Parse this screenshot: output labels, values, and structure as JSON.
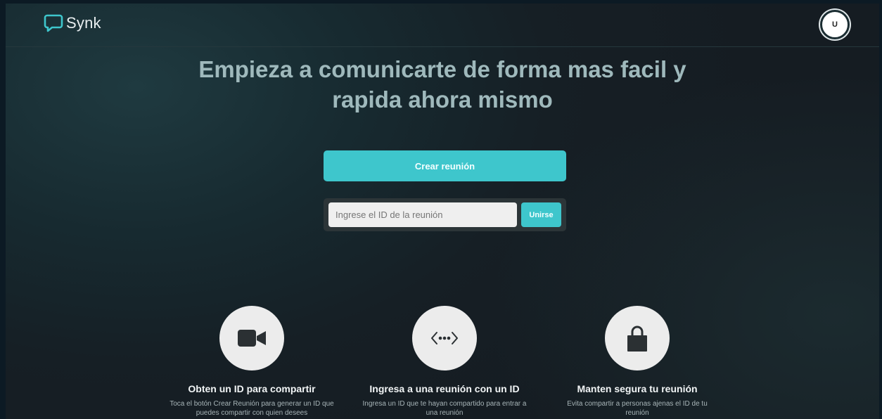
{
  "header": {
    "brand_name": "Synk",
    "avatar_initial": "U"
  },
  "hero": {
    "title_line1": "Empieza a comunicarte de forma mas facil y",
    "title_line2": "rapida ahora mismo"
  },
  "actions": {
    "create_label": "Crear reunión",
    "join_placeholder": "Ingrese el ID de la reunión",
    "join_value": "",
    "join_label": "Unirse"
  },
  "features": [
    {
      "icon": "video-camera-icon",
      "title": "Obten un ID para compartir",
      "description": "Toca el botón Crear Reunión para generar un ID que puedes compartir con quien desees"
    },
    {
      "icon": "code-dots-icon",
      "title": "Ingresa a una reunión con un ID",
      "description": "Ingresa un ID que te hayan compartido para entrar a una reunión"
    },
    {
      "icon": "lock-icon",
      "title": "Manten segura tu reunión",
      "description": "Evita compartir a personas ajenas el ID de tu reunión"
    }
  ],
  "colors": {
    "accent": "#3ec6cc",
    "background": "#172a30",
    "title_text": "#9fb9bc"
  }
}
